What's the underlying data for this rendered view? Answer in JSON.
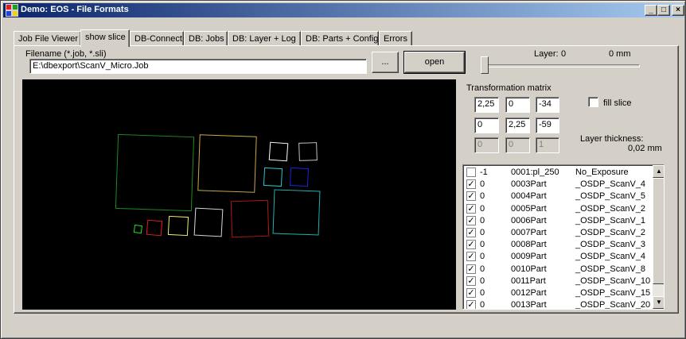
{
  "window": {
    "title": "Demo: EOS - File Formats"
  },
  "caption_buttons": {
    "minimize": "_",
    "maximize": "□",
    "close": "×"
  },
  "tabs": [
    "Job File Viewer",
    "show slice",
    "DB-Connect",
    "DB: Jobs",
    "DB: Layer + Log",
    "DB: Parts + Config",
    "Errors"
  ],
  "active_tab": "show slice",
  "filename": {
    "label": "Filename (*.job, *.sli)",
    "value": "E:\\dbexport\\ScanV_Micro.Job",
    "browse_label": "...",
    "open_label": "open"
  },
  "layer": {
    "label": "Layer:",
    "value": "0",
    "position": "0 mm",
    "slider_value": 0
  },
  "transformation": {
    "label": "Transformation matrix",
    "rows": [
      [
        "2,25",
        "0",
        "-34"
      ],
      [
        "0",
        "2,25",
        "-59"
      ],
      [
        "0",
        "0",
        "1"
      ]
    ]
  },
  "fill_slice": {
    "label": "fill slice",
    "checked": false
  },
  "layer_thickness": {
    "label": "Layer thickness:",
    "value": "0,02 mm"
  },
  "parts": [
    {
      "checked": false,
      "id": "-1",
      "name": "0001:pl_250",
      "exposure": "No_Exposure"
    },
    {
      "checked": true,
      "id": "0",
      "name": "0003Part",
      "exposure": "_OSDP_ScanV_4"
    },
    {
      "checked": true,
      "id": "0",
      "name": "0004Part",
      "exposure": "_OSDP_ScanV_5"
    },
    {
      "checked": true,
      "id": "0",
      "name": "0005Part",
      "exposure": "_OSDP_ScanV_2"
    },
    {
      "checked": true,
      "id": "0",
      "name": "0006Part",
      "exposure": "_OSDP_ScanV_1"
    },
    {
      "checked": true,
      "id": "0",
      "name": "0007Part",
      "exposure": "_OSDP_ScanV_2"
    },
    {
      "checked": true,
      "id": "0",
      "name": "0008Part",
      "exposure": "_OSDP_ScanV_3"
    },
    {
      "checked": true,
      "id": "0",
      "name": "0009Part",
      "exposure": "_OSDP_ScanV_4"
    },
    {
      "checked": true,
      "id": "0",
      "name": "0010Part",
      "exposure": "_OSDP_ScanV_8"
    },
    {
      "checked": true,
      "id": "0",
      "name": "0011Part",
      "exposure": "_OSDP_ScanV_10"
    },
    {
      "checked": true,
      "id": "0",
      "name": "0012Part",
      "exposure": "_OSDP_ScanV_15"
    },
    {
      "checked": true,
      "id": "0",
      "name": "0013Part",
      "exposure": "_OSDP_ScanV_20"
    }
  ],
  "colors": {
    "canvas_background": "#000000",
    "title_gradient_start": "#0a246a",
    "title_gradient_end": "#a6caf0",
    "slice_outlines": [
      "#1e8a1e",
      "#c8a848",
      "#ffffff",
      "#c0c0c0",
      "#20c8c8",
      "#2020e0",
      "#20b0b0",
      "#20e020",
      "#e02020",
      "#f0f060",
      "#d8d8d8",
      "#b01818"
    ]
  }
}
